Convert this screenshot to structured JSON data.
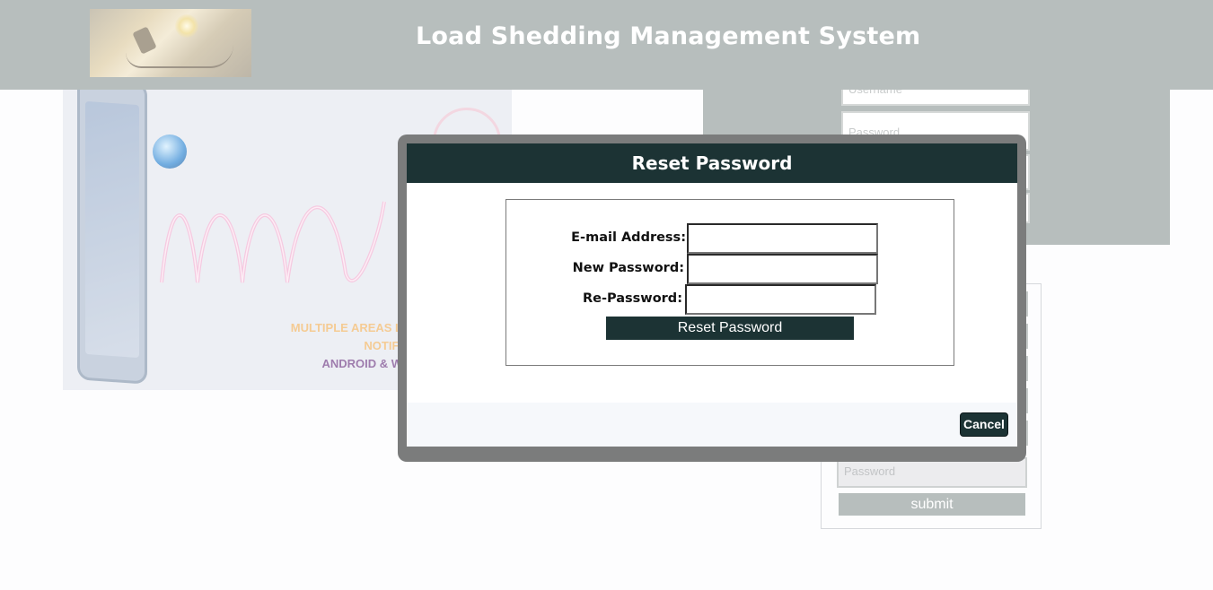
{
  "header": {
    "title": "Load Shedding Management System",
    "logo_icon": "bulb-plug-logo-icon"
  },
  "banner": {
    "line1": "MULTIPLE AREAS L",
    "line2": "NOTIFI",
    "line3": "ANDROID & W"
  },
  "login": {
    "username_placeholder": "Username",
    "password_placeholder": "Password"
  },
  "register": {
    "password_placeholder": "Password",
    "submit_label": "submit"
  },
  "modal": {
    "title": "Reset Password",
    "email_label": "E-mail Address:",
    "email_value": "",
    "new_password_label": "New Password:",
    "new_password_value": "",
    "re_password_label": "Re-Password:",
    "re_password_value": "",
    "reset_button_label": "Reset Password",
    "cancel_label": "Cancel"
  },
  "colors": {
    "header_bg": "#b7bebd",
    "modal_dark": "#1c3334",
    "overlay_frame": "#7b7c7c"
  }
}
